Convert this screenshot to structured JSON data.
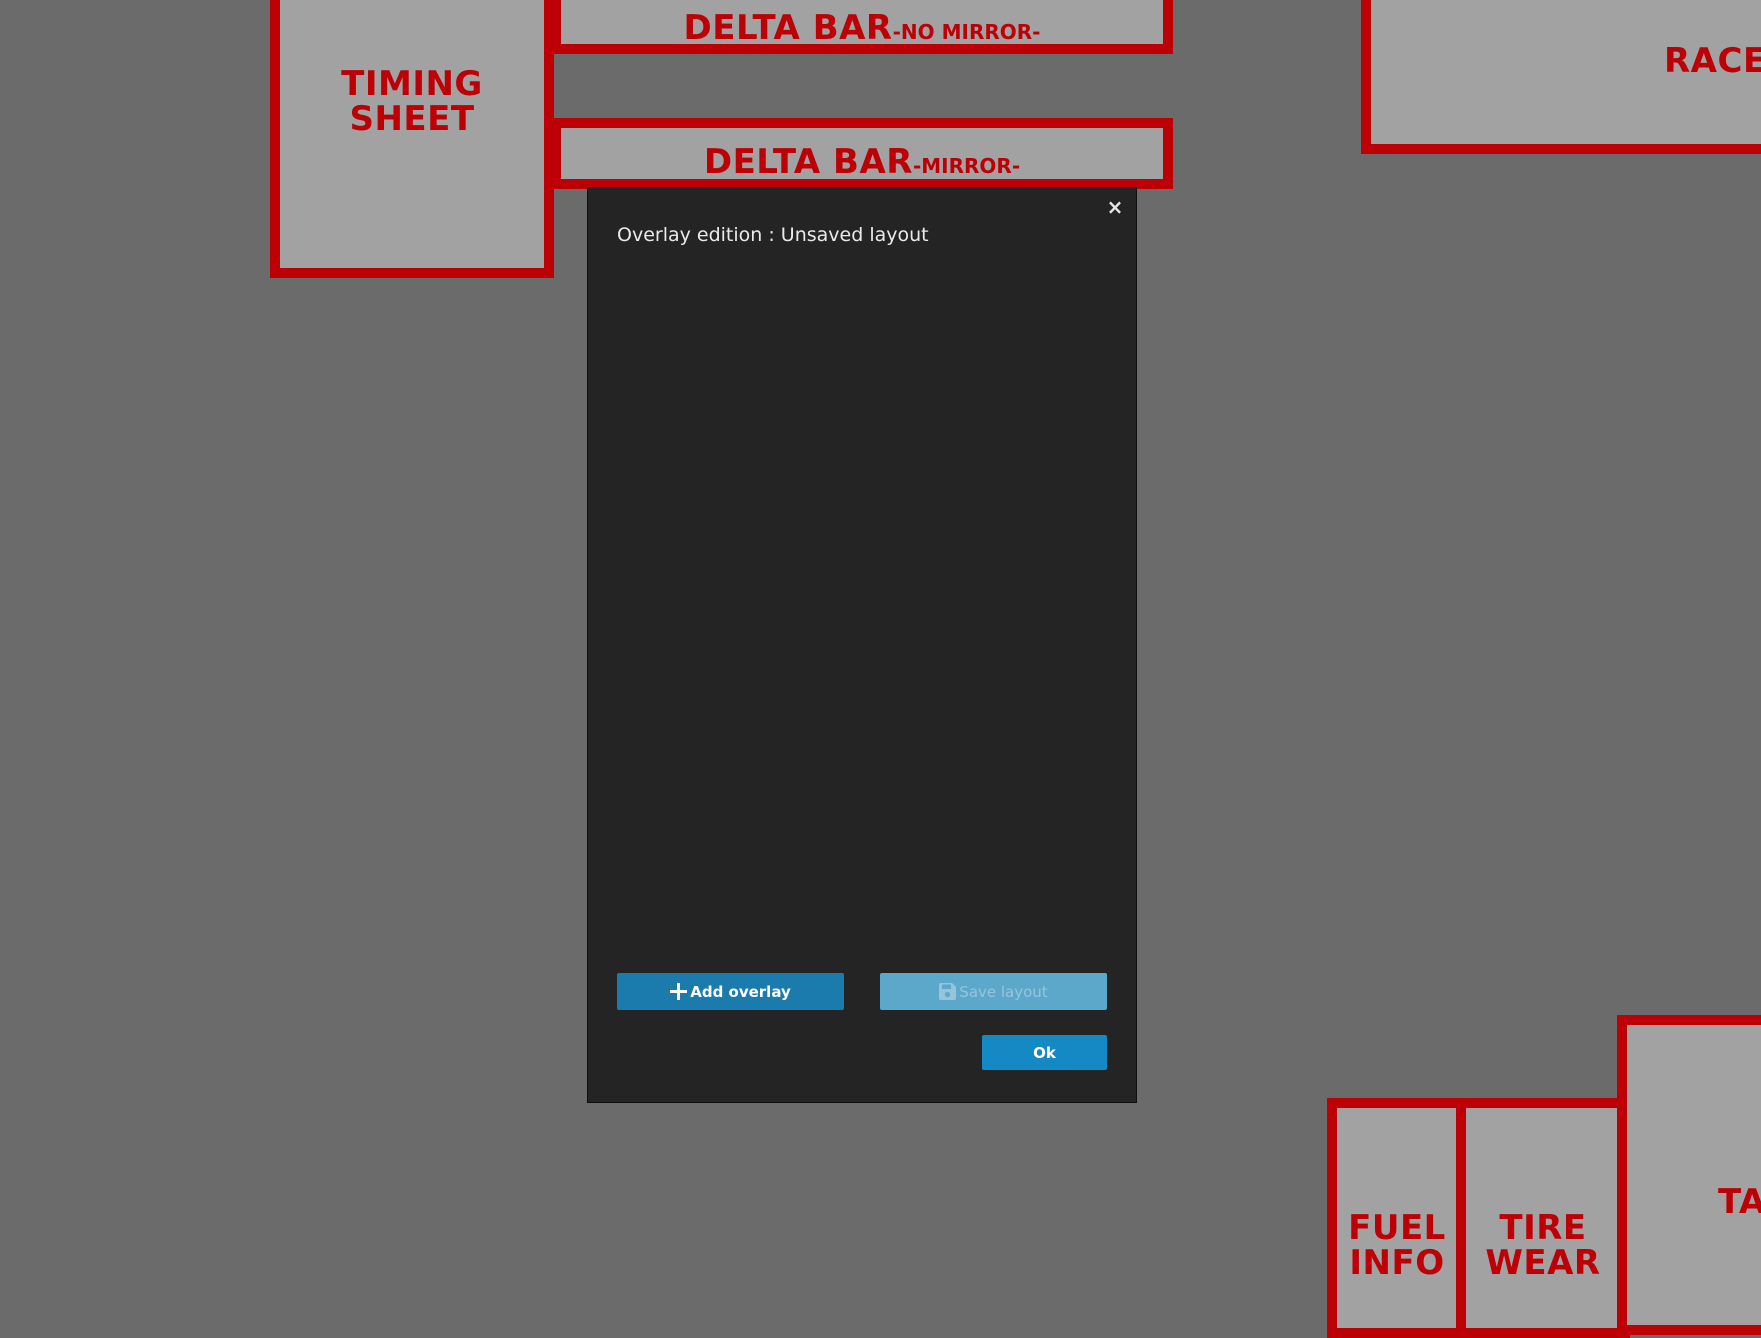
{
  "background_overlays": {
    "timing_sheet": {
      "line1": "TIMING",
      "line2": "SHEET"
    },
    "delta_bar_no_mirror": {
      "main": "DELTA BAR",
      "suffix": "-NO MIRROR-"
    },
    "delta_bar_mirror": {
      "main": "DELTA BAR",
      "suffix": "-MIRROR-"
    },
    "race": {
      "text": "RACE"
    },
    "fuel_info": {
      "line1": "FUEL",
      "line2": "INFO"
    },
    "tire_wear": {
      "line1": "TIRE",
      "line2": "WEAR"
    },
    "ta": {
      "text": "TA"
    }
  },
  "modal": {
    "title": "Overlay edition : Unsaved layout",
    "close_label": "×",
    "add_overlay_label": "Add overlay",
    "save_layout_label": "Save layout",
    "ok_label": "Ok"
  },
  "colors": {
    "desktop_background": "#6b6b6b",
    "overlay_fill": "#a2a2a2",
    "overlay_accent": "#bd0005",
    "modal_background": "#242424",
    "primary_button": "#1b7bad",
    "disabled_button": "#5ba8cb",
    "ok_button": "#1589c4"
  },
  "icons": {
    "add_button_icon": "plus-icon",
    "save_button_icon": "floppy-disk-icon",
    "close_icon": "close-icon"
  }
}
